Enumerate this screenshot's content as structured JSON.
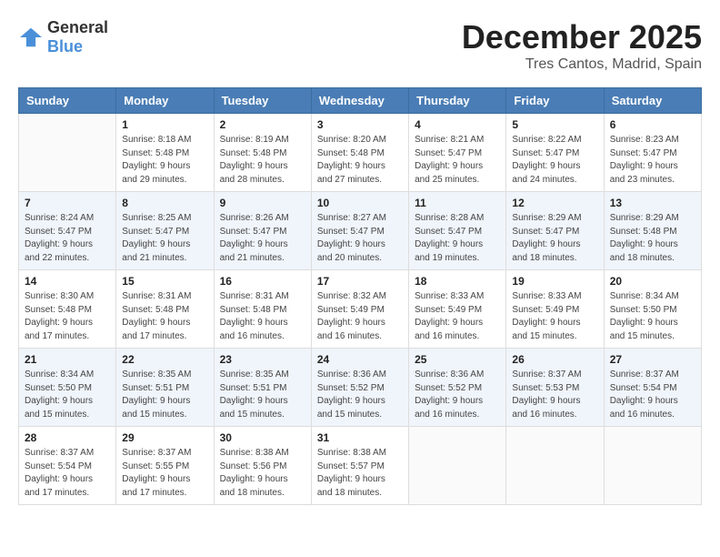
{
  "logo": {
    "text_general": "General",
    "text_blue": "Blue"
  },
  "title": {
    "month": "December 2025",
    "location": "Tres Cantos, Madrid, Spain"
  },
  "headers": [
    "Sunday",
    "Monday",
    "Tuesday",
    "Wednesday",
    "Thursday",
    "Friday",
    "Saturday"
  ],
  "weeks": [
    [
      {
        "day": "",
        "sunrise": "",
        "sunset": "",
        "daylight": ""
      },
      {
        "day": "1",
        "sunrise": "Sunrise: 8:18 AM",
        "sunset": "Sunset: 5:48 PM",
        "daylight": "Daylight: 9 hours and 29 minutes."
      },
      {
        "day": "2",
        "sunrise": "Sunrise: 8:19 AM",
        "sunset": "Sunset: 5:48 PM",
        "daylight": "Daylight: 9 hours and 28 minutes."
      },
      {
        "day": "3",
        "sunrise": "Sunrise: 8:20 AM",
        "sunset": "Sunset: 5:48 PM",
        "daylight": "Daylight: 9 hours and 27 minutes."
      },
      {
        "day": "4",
        "sunrise": "Sunrise: 8:21 AM",
        "sunset": "Sunset: 5:47 PM",
        "daylight": "Daylight: 9 hours and 25 minutes."
      },
      {
        "day": "5",
        "sunrise": "Sunrise: 8:22 AM",
        "sunset": "Sunset: 5:47 PM",
        "daylight": "Daylight: 9 hours and 24 minutes."
      },
      {
        "day": "6",
        "sunrise": "Sunrise: 8:23 AM",
        "sunset": "Sunset: 5:47 PM",
        "daylight": "Daylight: 9 hours and 23 minutes."
      }
    ],
    [
      {
        "day": "7",
        "sunrise": "Sunrise: 8:24 AM",
        "sunset": "Sunset: 5:47 PM",
        "daylight": "Daylight: 9 hours and 22 minutes."
      },
      {
        "day": "8",
        "sunrise": "Sunrise: 8:25 AM",
        "sunset": "Sunset: 5:47 PM",
        "daylight": "Daylight: 9 hours and 21 minutes."
      },
      {
        "day": "9",
        "sunrise": "Sunrise: 8:26 AM",
        "sunset": "Sunset: 5:47 PM",
        "daylight": "Daylight: 9 hours and 21 minutes."
      },
      {
        "day": "10",
        "sunrise": "Sunrise: 8:27 AM",
        "sunset": "Sunset: 5:47 PM",
        "daylight": "Daylight: 9 hours and 20 minutes."
      },
      {
        "day": "11",
        "sunrise": "Sunrise: 8:28 AM",
        "sunset": "Sunset: 5:47 PM",
        "daylight": "Daylight: 9 hours and 19 minutes."
      },
      {
        "day": "12",
        "sunrise": "Sunrise: 8:29 AM",
        "sunset": "Sunset: 5:47 PM",
        "daylight": "Daylight: 9 hours and 18 minutes."
      },
      {
        "day": "13",
        "sunrise": "Sunrise: 8:29 AM",
        "sunset": "Sunset: 5:48 PM",
        "daylight": "Daylight: 9 hours and 18 minutes."
      }
    ],
    [
      {
        "day": "14",
        "sunrise": "Sunrise: 8:30 AM",
        "sunset": "Sunset: 5:48 PM",
        "daylight": "Daylight: 9 hours and 17 minutes."
      },
      {
        "day": "15",
        "sunrise": "Sunrise: 8:31 AM",
        "sunset": "Sunset: 5:48 PM",
        "daylight": "Daylight: 9 hours and 17 minutes."
      },
      {
        "day": "16",
        "sunrise": "Sunrise: 8:31 AM",
        "sunset": "Sunset: 5:48 PM",
        "daylight": "Daylight: 9 hours and 16 minutes."
      },
      {
        "day": "17",
        "sunrise": "Sunrise: 8:32 AM",
        "sunset": "Sunset: 5:49 PM",
        "daylight": "Daylight: 9 hours and 16 minutes."
      },
      {
        "day": "18",
        "sunrise": "Sunrise: 8:33 AM",
        "sunset": "Sunset: 5:49 PM",
        "daylight": "Daylight: 9 hours and 16 minutes."
      },
      {
        "day": "19",
        "sunrise": "Sunrise: 8:33 AM",
        "sunset": "Sunset: 5:49 PM",
        "daylight": "Daylight: 9 hours and 15 minutes."
      },
      {
        "day": "20",
        "sunrise": "Sunrise: 8:34 AM",
        "sunset": "Sunset: 5:50 PM",
        "daylight": "Daylight: 9 hours and 15 minutes."
      }
    ],
    [
      {
        "day": "21",
        "sunrise": "Sunrise: 8:34 AM",
        "sunset": "Sunset: 5:50 PM",
        "daylight": "Daylight: 9 hours and 15 minutes."
      },
      {
        "day": "22",
        "sunrise": "Sunrise: 8:35 AM",
        "sunset": "Sunset: 5:51 PM",
        "daylight": "Daylight: 9 hours and 15 minutes."
      },
      {
        "day": "23",
        "sunrise": "Sunrise: 8:35 AM",
        "sunset": "Sunset: 5:51 PM",
        "daylight": "Daylight: 9 hours and 15 minutes."
      },
      {
        "day": "24",
        "sunrise": "Sunrise: 8:36 AM",
        "sunset": "Sunset: 5:52 PM",
        "daylight": "Daylight: 9 hours and 15 minutes."
      },
      {
        "day": "25",
        "sunrise": "Sunrise: 8:36 AM",
        "sunset": "Sunset: 5:52 PM",
        "daylight": "Daylight: 9 hours and 16 minutes."
      },
      {
        "day": "26",
        "sunrise": "Sunrise: 8:37 AM",
        "sunset": "Sunset: 5:53 PM",
        "daylight": "Daylight: 9 hours and 16 minutes."
      },
      {
        "day": "27",
        "sunrise": "Sunrise: 8:37 AM",
        "sunset": "Sunset: 5:54 PM",
        "daylight": "Daylight: 9 hours and 16 minutes."
      }
    ],
    [
      {
        "day": "28",
        "sunrise": "Sunrise: 8:37 AM",
        "sunset": "Sunset: 5:54 PM",
        "daylight": "Daylight: 9 hours and 17 minutes."
      },
      {
        "day": "29",
        "sunrise": "Sunrise: 8:37 AM",
        "sunset": "Sunset: 5:55 PM",
        "daylight": "Daylight: 9 hours and 17 minutes."
      },
      {
        "day": "30",
        "sunrise": "Sunrise: 8:38 AM",
        "sunset": "Sunset: 5:56 PM",
        "daylight": "Daylight: 9 hours and 18 minutes."
      },
      {
        "day": "31",
        "sunrise": "Sunrise: 8:38 AM",
        "sunset": "Sunset: 5:57 PM",
        "daylight": "Daylight: 9 hours and 18 minutes."
      },
      {
        "day": "",
        "sunrise": "",
        "sunset": "",
        "daylight": ""
      },
      {
        "day": "",
        "sunrise": "",
        "sunset": "",
        "daylight": ""
      },
      {
        "day": "",
        "sunrise": "",
        "sunset": "",
        "daylight": ""
      }
    ]
  ],
  "row_backgrounds": [
    "#fff",
    "#f0f5fb",
    "#fff",
    "#f0f5fb",
    "#fff"
  ]
}
